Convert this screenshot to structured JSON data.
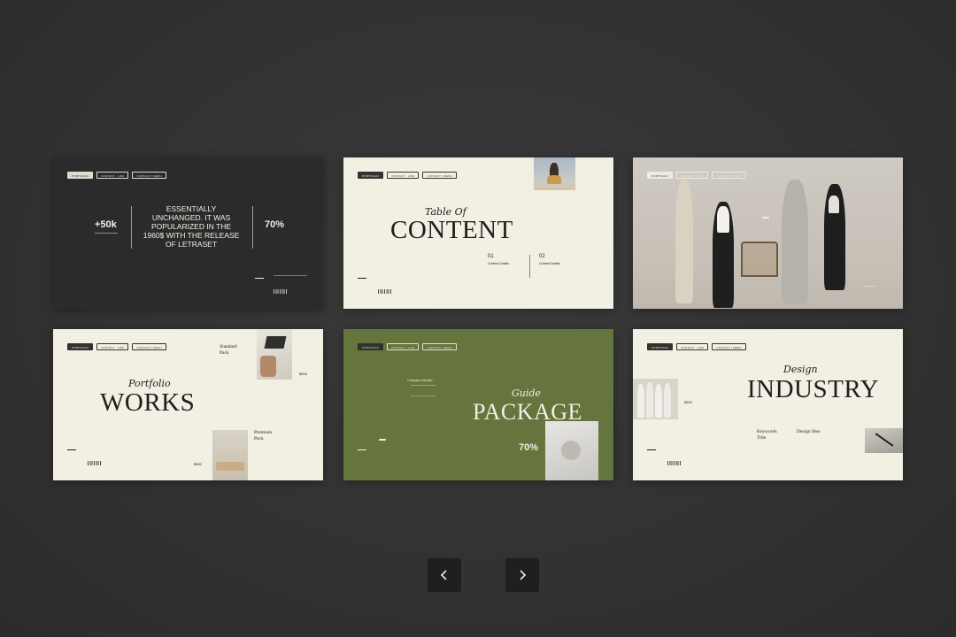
{
  "navigation": {
    "prev_icon": "chevron-left-icon",
    "next_icon": "chevron-right-icon"
  },
  "slides": [
    {
      "tabs": [
        "PORTFOLIO",
        "CONTACT · LINK",
        "CONTACT / MENU"
      ],
      "stat_left": "+50k",
      "stat_right": "70%",
      "headline": "ESSENTIALLY UNCHANGED. IT WAS POPULARIZED IN THE 1960$ WITH THE RELEASE OF LETRASET"
    },
    {
      "tabs": [
        "PORTFOLIO",
        "CONTACT · LINK",
        "CONTACT / MENU"
      ],
      "script": "Table Of",
      "title": "CONTENT",
      "items": [
        {
          "num": "01",
          "label": "Content Details"
        },
        {
          "num": "02",
          "label": "Content Details"
        }
      ]
    },
    {
      "tabs": [
        "PORTFOLIO",
        "CONTACT · LINK",
        "CONTACT / MENU"
      ]
    },
    {
      "tabs": [
        "PORTFOLIO",
        "CONTACT · LINK",
        "CONTACT / MENU"
      ],
      "script": "Portfolio",
      "title": "WORKS",
      "pack1": "Standard Pack",
      "pack2": "Premium Pack",
      "price1": "$500",
      "price2": "$900"
    },
    {
      "tabs": [
        "PORTFOLIO",
        "CONTACT · LINK",
        "CONTACT / MENU"
      ],
      "script": "Guide",
      "title": "PACKAGE",
      "company": "Company Sample /",
      "stat": "70%"
    },
    {
      "tabs": [
        "PORTFOLIO",
        "CONTACT · LINK",
        "CONTACT / MENU"
      ],
      "script": "Design",
      "title": "INDUSTRY",
      "col1": "Keywords Title",
      "col2": "Design Idea",
      "price": "$500"
    }
  ],
  "colors": {
    "background": "#343434",
    "cream": "#f2efe3",
    "dark": "#2b2b2b",
    "olive": "#66743d",
    "button": "#1f1f1f"
  }
}
